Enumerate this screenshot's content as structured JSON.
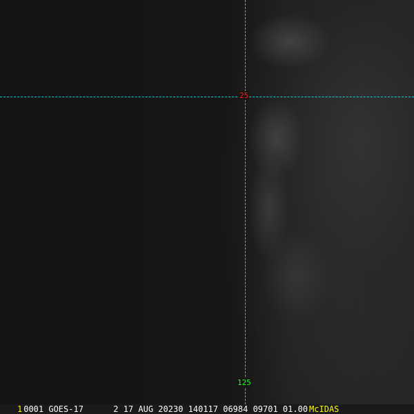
{
  "overlay": {
    "latitude_label": "25",
    "longitude_label": "125",
    "grid_color": "#00d8e8"
  },
  "status_bar": {
    "frame": "1",
    "info": "0001 GOES-17      2 17 AUG 20230 140117 06984 09701 01.00",
    "brand": "McIDAS"
  }
}
